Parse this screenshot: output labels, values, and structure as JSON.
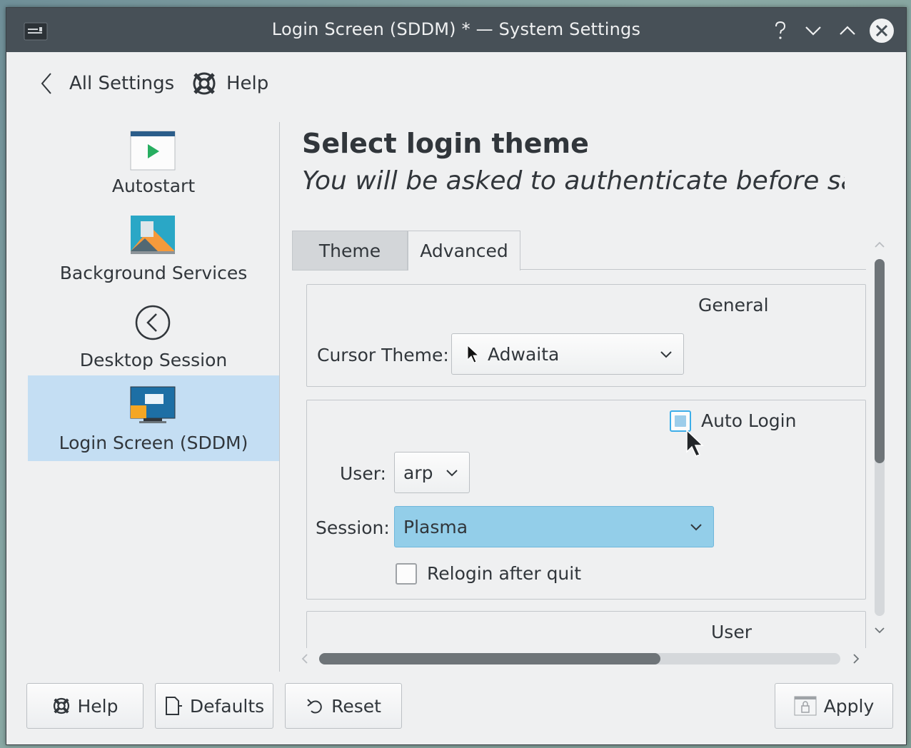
{
  "window": {
    "title": "Login Screen (SDDM) * — System Settings"
  },
  "navbar": {
    "back_label": "All Settings",
    "help_label": "Help"
  },
  "sidebar": {
    "items": [
      {
        "label": "Autostart",
        "icon": "autostart-icon"
      },
      {
        "label": "Background Services",
        "icon": "background-services-icon"
      },
      {
        "label": "Desktop Session",
        "icon": "desktop-session-icon"
      },
      {
        "label": "Login Screen (SDDM)",
        "icon": "login-screen-icon",
        "active": true
      }
    ]
  },
  "main": {
    "heading": "Select login theme",
    "subheading": "You will be asked to authenticate before saving",
    "tabs": [
      {
        "label": "Theme",
        "active": false
      },
      {
        "label": "Advanced",
        "active": true
      }
    ],
    "general": {
      "title": "General",
      "cursor_theme_label": "Cursor Theme:",
      "cursor_theme_value": "Adwaita"
    },
    "autologin": {
      "checkbox_label": "Auto Login",
      "checked": false,
      "user_label": "User:",
      "user_value": "arp",
      "session_label": "Session:",
      "session_value": "Plasma",
      "relogin_label": "Relogin after quit",
      "relogin_checked": false
    },
    "user_group": {
      "title": "User"
    }
  },
  "footer": {
    "help_label": "Help",
    "defaults_label": "Defaults",
    "reset_label": "Reset",
    "apply_label": "Apply"
  },
  "colors": {
    "titlebar": "#475057",
    "selection": "#c4def3",
    "accent": "#3daee9",
    "combo_highlight": "#93cee9"
  }
}
